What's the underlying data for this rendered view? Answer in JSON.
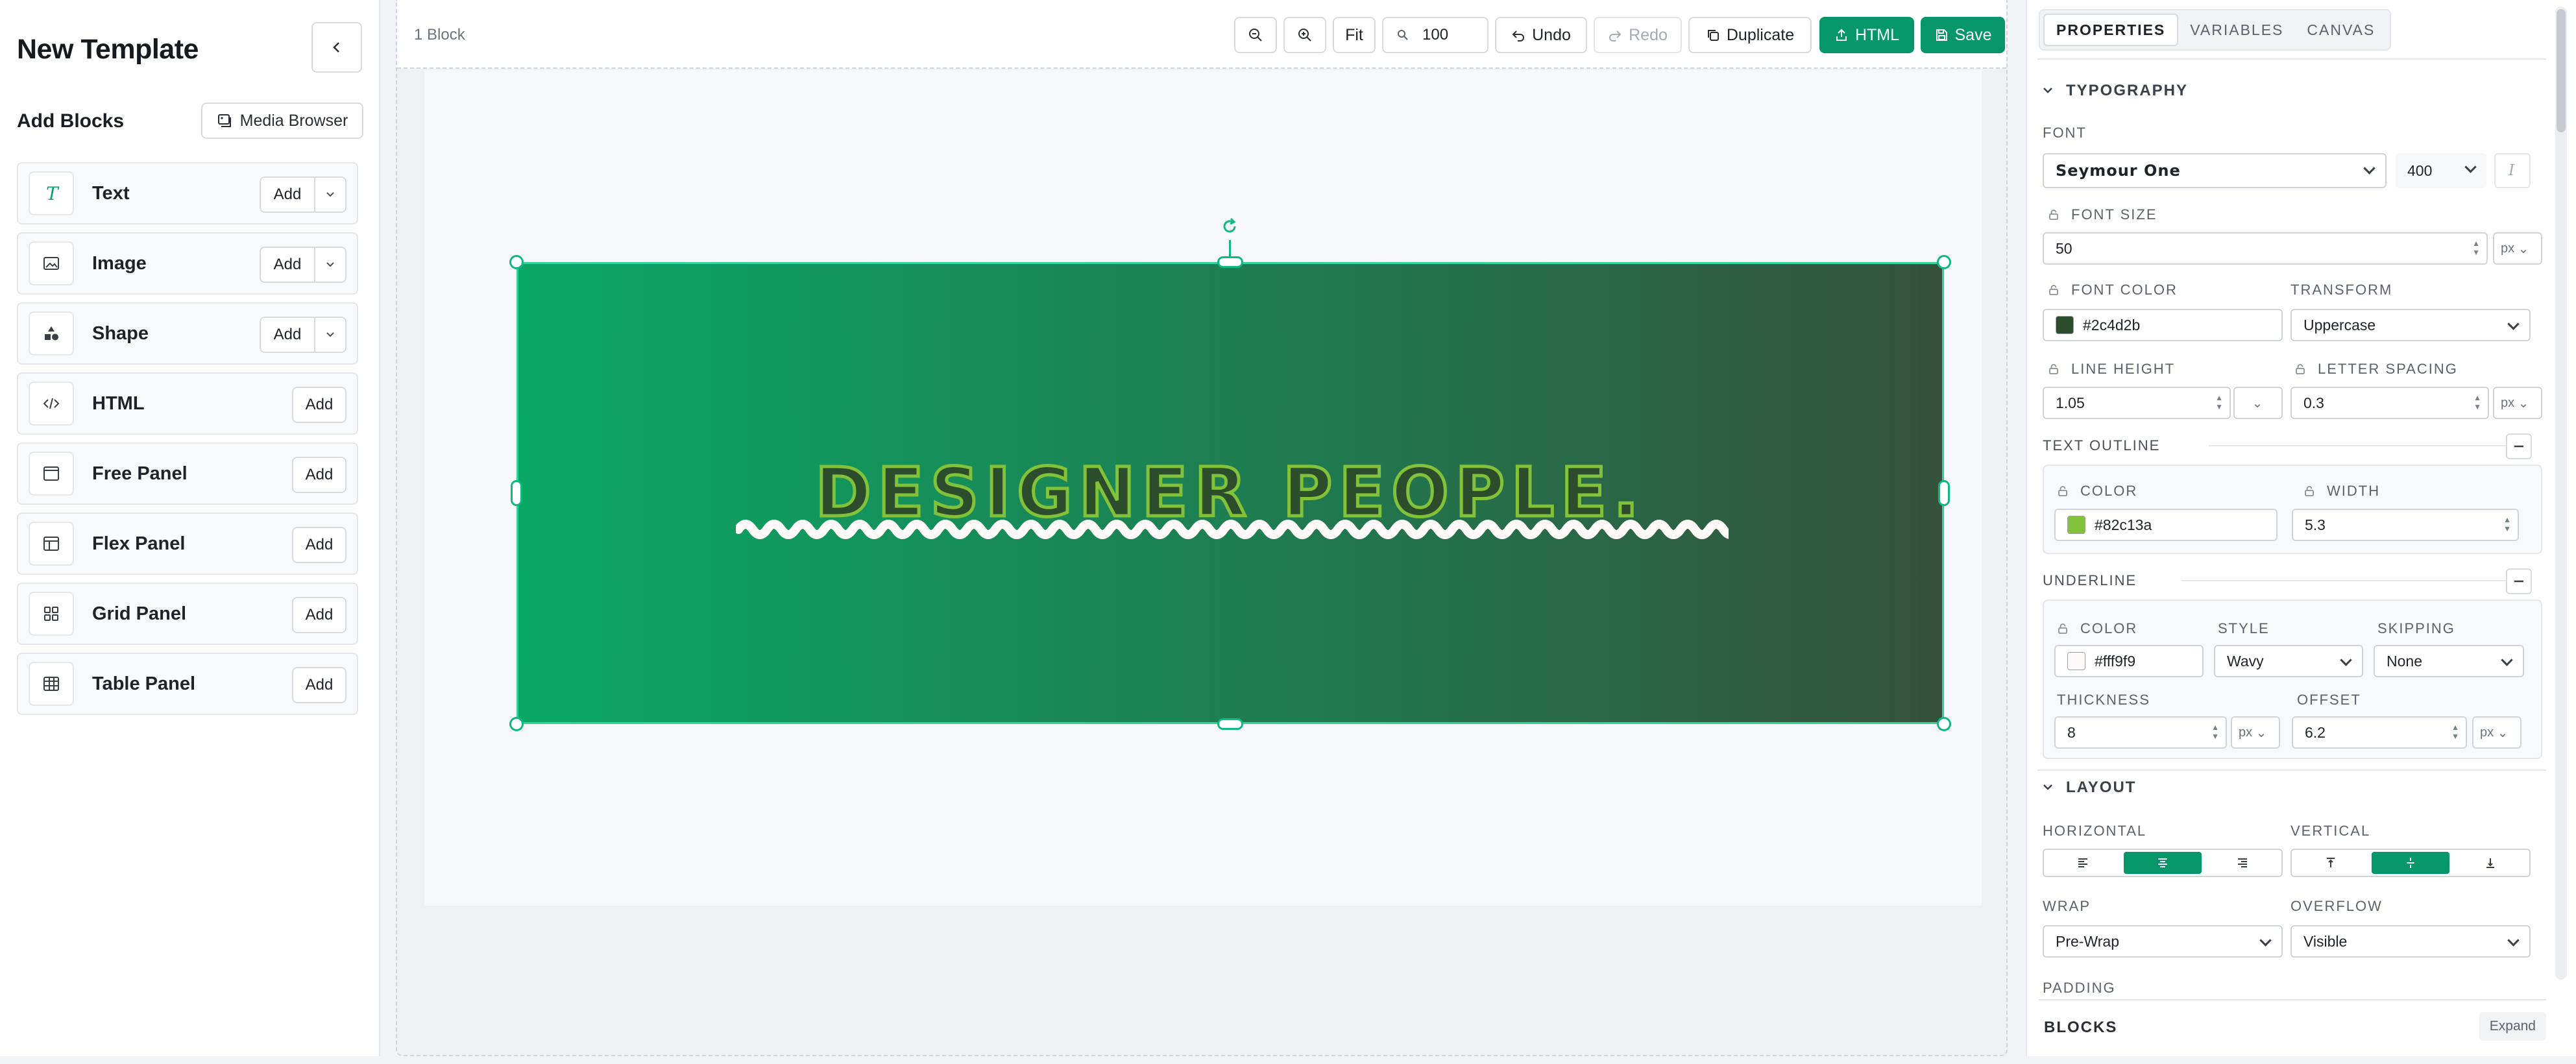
{
  "left_panel": {
    "title": "New Template",
    "add_blocks_label": "Add Blocks",
    "media_browser_label": "Media Browser",
    "blocks": [
      {
        "label": "Text",
        "add": "Add",
        "has_dropdown": true,
        "icon": "text-icon"
      },
      {
        "label": "Image",
        "add": "Add",
        "has_dropdown": true,
        "icon": "image-icon"
      },
      {
        "label": "Shape",
        "add": "Add",
        "has_dropdown": true,
        "icon": "shape-icon"
      },
      {
        "label": "HTML",
        "add": "Add",
        "has_dropdown": false,
        "icon": "code-icon"
      },
      {
        "label": "Free Panel",
        "add": "Add",
        "has_dropdown": false,
        "icon": "free-panel-icon"
      },
      {
        "label": "Flex Panel",
        "add": "Add",
        "has_dropdown": false,
        "icon": "flex-panel-icon"
      },
      {
        "label": "Grid Panel",
        "add": "Add",
        "has_dropdown": false,
        "icon": "grid-panel-icon"
      },
      {
        "label": "Table Panel",
        "add": "Add",
        "has_dropdown": false,
        "icon": "table-panel-icon"
      }
    ]
  },
  "toolbar": {
    "block_count": "1 Block",
    "fit": "Fit",
    "zoom_value": "100",
    "undo": "Undo",
    "redo": "Redo",
    "duplicate": "Duplicate",
    "html": "HTML",
    "save": "Save"
  },
  "canvas": {
    "banner_text": "Designer People.",
    "gradient_start": "#0aa865",
    "gradient_end": "#35513a"
  },
  "right_panel": {
    "tabs": [
      "PROPERTIES",
      "VARIABLES",
      "CANVAS"
    ],
    "active_tab": "PROPERTIES",
    "typography": {
      "header": "TYPOGRAPHY",
      "font_label": "FONT",
      "font_value": "Seymour One",
      "weight_value": "400",
      "italic_label": "I",
      "font_size_label": "FONT SIZE",
      "font_size_value": "50",
      "font_size_unit": "px",
      "font_color_label": "FONT COLOR",
      "font_color_value": "#2c4d2b",
      "transform_label": "TRANSFORM",
      "transform_value": "Uppercase",
      "line_height_label": "LINE HEIGHT",
      "line_height_value": "1.05",
      "letter_spacing_label": "LETTER SPACING",
      "letter_spacing_value": "0.3",
      "letter_spacing_unit": "px"
    },
    "text_outline": {
      "header": "TEXT OUTLINE",
      "color_label": "COLOR",
      "color_value": "#82c13a",
      "width_label": "WIDTH",
      "width_value": "5.3"
    },
    "underline": {
      "header": "UNDERLINE",
      "color_label": "COLOR",
      "color_value": "#fff9f9",
      "style_label": "STYLE",
      "style_value": "Wavy",
      "skipping_label": "SKIPPING",
      "skipping_value": "None",
      "thickness_label": "THICKNESS",
      "thickness_value": "8",
      "thickness_unit": "px",
      "offset_label": "OFFSET",
      "offset_value": "6.2",
      "offset_unit": "px"
    },
    "layout": {
      "header": "LAYOUT",
      "horizontal_label": "HORIZONTAL",
      "vertical_label": "VERTICAL",
      "wrap_label": "WRAP",
      "wrap_value": "Pre-Wrap",
      "overflow_label": "OVERFLOW",
      "overflow_value": "Visible",
      "padding_label": "PADDING"
    },
    "blocks": {
      "label": "BLOCKS",
      "expand": "Expand"
    }
  },
  "colors": {
    "accent": "#059669",
    "selection": "#10b981"
  }
}
